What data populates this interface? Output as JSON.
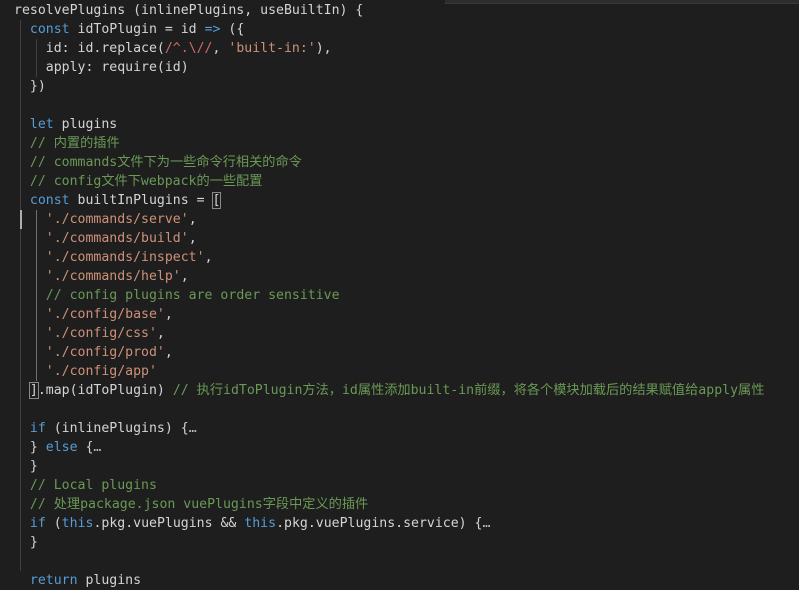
{
  "theme": {
    "background": "#1e1e1e",
    "colors": {
      "plain": "#d4d4d4",
      "keyword": "#569cd6",
      "string": "#ce9178",
      "comment": "#6a9955",
      "regex": "#d16969",
      "fold": "#bbbbbb"
    }
  },
  "editor": {
    "language": "javascript",
    "lines": [
      {
        "tokens": [
          [
            "plain",
            "resolvePlugins (inlinePlugins, useBuiltIn) {"
          ]
        ]
      },
      {
        "tokens": [
          [
            "plain",
            "  "
          ],
          [
            "keyword",
            "const"
          ],
          [
            "plain",
            " idToPlugin = id "
          ],
          [
            "keyword",
            "=>"
          ],
          [
            "plain",
            " ({"
          ]
        ]
      },
      {
        "tokens": [
          [
            "plain",
            "    id: id.replace("
          ],
          [
            "regex",
            "/^.\\//"
          ],
          [
            "plain",
            ", "
          ],
          [
            "string",
            "'built-in:'"
          ],
          [
            "plain",
            "),"
          ]
        ]
      },
      {
        "tokens": [
          [
            "plain",
            "    apply: require(id)"
          ]
        ]
      },
      {
        "tokens": [
          [
            "plain",
            "  })"
          ]
        ]
      },
      {
        "tokens": []
      },
      {
        "tokens": [
          [
            "plain",
            "  "
          ],
          [
            "keyword",
            "let"
          ],
          [
            "plain",
            " plugins"
          ]
        ]
      },
      {
        "tokens": [
          [
            "plain",
            "  "
          ],
          [
            "comment",
            "// 内置的插件"
          ]
        ]
      },
      {
        "tokens": [
          [
            "plain",
            "  "
          ],
          [
            "comment",
            "// commands文件下为一些命令行相关的命令"
          ]
        ]
      },
      {
        "tokens": [
          [
            "plain",
            "  "
          ],
          [
            "comment",
            "// config文件下webpack的一些配置"
          ]
        ]
      },
      {
        "tokens": [
          [
            "plain",
            "  "
          ],
          [
            "keyword",
            "const"
          ],
          [
            "plain",
            " builtInPlugins = "
          ],
          [
            "bracket",
            "["
          ]
        ]
      },
      {
        "tokens": [
          [
            "plain",
            "    "
          ],
          [
            "string",
            "'./commands/serve'"
          ],
          [
            "plain",
            ","
          ]
        ],
        "cursor": true
      },
      {
        "tokens": [
          [
            "plain",
            "    "
          ],
          [
            "string",
            "'./commands/build'"
          ],
          [
            "plain",
            ","
          ]
        ]
      },
      {
        "tokens": [
          [
            "plain",
            "    "
          ],
          [
            "string",
            "'./commands/inspect'"
          ],
          [
            "plain",
            ","
          ]
        ]
      },
      {
        "tokens": [
          [
            "plain",
            "    "
          ],
          [
            "string",
            "'./commands/help'"
          ],
          [
            "plain",
            ","
          ]
        ]
      },
      {
        "tokens": [
          [
            "plain",
            "    "
          ],
          [
            "comment",
            "// config plugins are order sensitive"
          ]
        ]
      },
      {
        "tokens": [
          [
            "plain",
            "    "
          ],
          [
            "string",
            "'./config/base'"
          ],
          [
            "plain",
            ","
          ]
        ]
      },
      {
        "tokens": [
          [
            "plain",
            "    "
          ],
          [
            "string",
            "'./config/css'"
          ],
          [
            "plain",
            ","
          ]
        ]
      },
      {
        "tokens": [
          [
            "plain",
            "    "
          ],
          [
            "string",
            "'./config/prod'"
          ],
          [
            "plain",
            ","
          ]
        ]
      },
      {
        "tokens": [
          [
            "plain",
            "    "
          ],
          [
            "string",
            "'./config/app'"
          ]
        ]
      },
      {
        "tokens": [
          [
            "plain",
            "  "
          ],
          [
            "bracket",
            "]"
          ],
          [
            "plain",
            ".map(idToPlugin) "
          ],
          [
            "comment",
            "// 执行idToPlugin方法，id属性添加built-in前缀，将各个模块加载后的结果赋值给apply属性"
          ]
        ]
      },
      {
        "tokens": []
      },
      {
        "tokens": [
          [
            "plain",
            "  "
          ],
          [
            "keyword",
            "if"
          ],
          [
            "plain",
            " (inlinePlugins) {"
          ],
          [
            "fold",
            "…"
          ]
        ]
      },
      {
        "tokens": [
          [
            "plain",
            "  } "
          ],
          [
            "keyword",
            "else"
          ],
          [
            "plain",
            " {"
          ],
          [
            "fold",
            "…"
          ]
        ]
      },
      {
        "tokens": [
          [
            "plain",
            "  }"
          ]
        ]
      },
      {
        "tokens": [
          [
            "plain",
            "  "
          ],
          [
            "comment",
            "// Local plugins"
          ]
        ]
      },
      {
        "tokens": [
          [
            "plain",
            "  "
          ],
          [
            "comment",
            "// 处理package.json vuePlugins字段中定义的插件"
          ]
        ]
      },
      {
        "tokens": [
          [
            "plain",
            "  "
          ],
          [
            "keyword",
            "if"
          ],
          [
            "plain",
            " ("
          ],
          [
            "keyword",
            "this"
          ],
          [
            "plain",
            ".pkg.vuePlugins && "
          ],
          [
            "keyword",
            "this"
          ],
          [
            "plain",
            ".pkg.vuePlugins.service) {"
          ],
          [
            "fold",
            "…"
          ]
        ]
      },
      {
        "tokens": [
          [
            "plain",
            "  }"
          ]
        ]
      },
      {
        "tokens": []
      },
      {
        "tokens": [
          [
            "plain",
            "  "
          ],
          [
            "keyword",
            "return"
          ],
          [
            "plain",
            " plugins"
          ]
        ]
      }
    ]
  }
}
